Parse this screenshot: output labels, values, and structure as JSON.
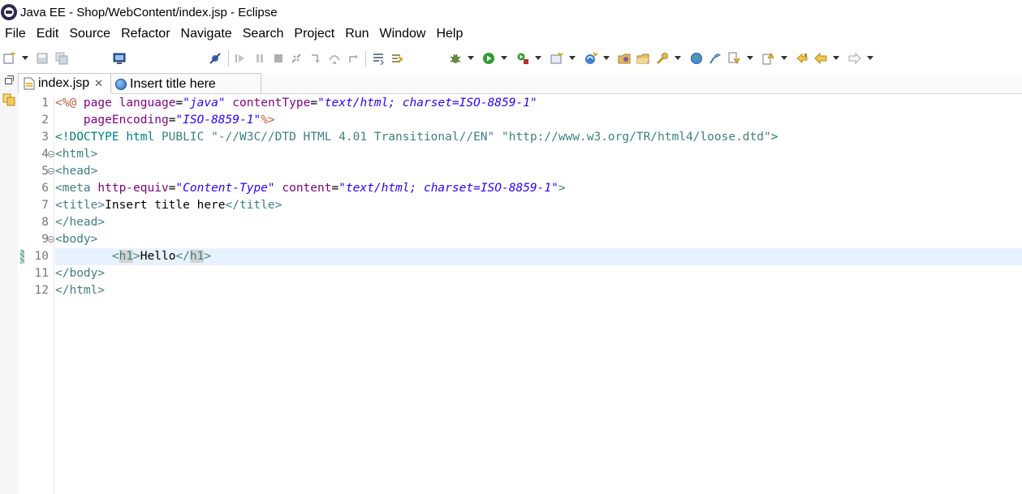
{
  "window": {
    "title": "Java EE - Shop/WebContent/index.jsp - Eclipse"
  },
  "menu": [
    "File",
    "Edit",
    "Source",
    "Refactor",
    "Navigate",
    "Search",
    "Project",
    "Run",
    "Window",
    "Help"
  ],
  "toolbar_icons": [
    "new-icon",
    "save-icon",
    "save-all-icon",
    "terminal-icon",
    "skip-breakpoints-icon",
    "resume-icon",
    "suspend-icon",
    "terminate-icon",
    "disconnect-icon",
    "step-into-icon",
    "step-over-icon",
    "step-return-icon",
    "drop-to-frame-icon",
    "use-step-filters-icon",
    "debug-icon",
    "run-icon",
    "run-last-tool-icon",
    "new-server-icon",
    "new-web-service-icon",
    "open-type-icon",
    "open-task-icon",
    "search-icon",
    "web-browser-icon",
    "annotation-icon",
    "next-annotation-icon",
    "last-edit-icon",
    "back-icon",
    "forward-icon"
  ],
  "tabs": [
    {
      "label": "index.jsp",
      "active": true
    },
    {
      "label": "Insert title here",
      "active": false
    }
  ],
  "editor": {
    "current_line": 10,
    "lines": [
      {
        "num": "1",
        "parts": [
          {
            "c": "t-jsp",
            "t": "<%@"
          },
          {
            "c": "t-attr",
            "t": " page "
          },
          {
            "c": "t-attr",
            "t": "language"
          },
          {
            "c": "t-txt",
            "t": "="
          },
          {
            "c": "t-val",
            "t": "\"java\""
          },
          {
            "c": "t-attr",
            "t": " contentType"
          },
          {
            "c": "t-txt",
            "t": "="
          },
          {
            "c": "t-val",
            "t": "\"text/html; charset=ISO-8859-1\""
          }
        ]
      },
      {
        "num": "2",
        "parts": [
          {
            "c": "t-attr",
            "t": "    pageEncoding"
          },
          {
            "c": "t-txt",
            "t": "="
          },
          {
            "c": "t-val",
            "t": "\"ISO-8859-1\""
          },
          {
            "c": "t-jsp",
            "t": "%>"
          }
        ]
      },
      {
        "num": "3",
        "parts": [
          {
            "c": "t-doc",
            "t": "<!DOCTYPE html "
          },
          {
            "c": "t-kw",
            "t": "PUBLIC "
          },
          {
            "c": "t-str",
            "t": "\"-//W3C//DTD HTML 4.01 Transitional//EN\" \"http://www.w3.org/TR/html4/loose.dtd\""
          },
          {
            "c": "t-doc",
            "t": ">"
          }
        ]
      },
      {
        "num": "4",
        "fold": true,
        "parts": [
          {
            "c": "t-tag",
            "t": "<html>"
          }
        ]
      },
      {
        "num": "5",
        "fold": true,
        "parts": [
          {
            "c": "t-tag",
            "t": "<head>"
          }
        ]
      },
      {
        "num": "6",
        "parts": [
          {
            "c": "t-tag",
            "t": "<meta"
          },
          {
            "c": "t-attr",
            "t": " http-equiv"
          },
          {
            "c": "t-txt",
            "t": "="
          },
          {
            "c": "t-val",
            "t": "\"Content-Type\""
          },
          {
            "c": "t-attr",
            "t": " content"
          },
          {
            "c": "t-txt",
            "t": "="
          },
          {
            "c": "t-val",
            "t": "\"text/html; charset=ISO-8859-1\""
          },
          {
            "c": "t-tag",
            "t": ">"
          }
        ]
      },
      {
        "num": "7",
        "parts": [
          {
            "c": "t-tag",
            "t": "<title>"
          },
          {
            "c": "t-txt",
            "t": "Insert title here"
          },
          {
            "c": "t-tag",
            "t": "</title>"
          }
        ]
      },
      {
        "num": "8",
        "parts": [
          {
            "c": "t-tag",
            "t": "</head>"
          }
        ]
      },
      {
        "num": "9",
        "fold": true,
        "parts": [
          {
            "c": "t-tag",
            "t": "<body>"
          }
        ]
      },
      {
        "num": "10",
        "parts": [
          {
            "c": "t-txt",
            "t": "        "
          },
          {
            "c": "t-tag",
            "t": "<"
          },
          {
            "c": "t-tag hl",
            "t": "h1"
          },
          {
            "c": "t-tag",
            "t": ">"
          },
          {
            "c": "t-txt",
            "t": "Hello"
          },
          {
            "c": "t-tag",
            "t": "</"
          },
          {
            "c": "t-tag hl",
            "t": "h1"
          },
          {
            "c": "t-tag",
            "t": ">"
          }
        ]
      },
      {
        "num": "11",
        "parts": [
          {
            "c": "t-tag",
            "t": "</body>"
          }
        ]
      },
      {
        "num": "12",
        "parts": [
          {
            "c": "t-tag",
            "t": "</html>"
          }
        ]
      }
    ]
  }
}
